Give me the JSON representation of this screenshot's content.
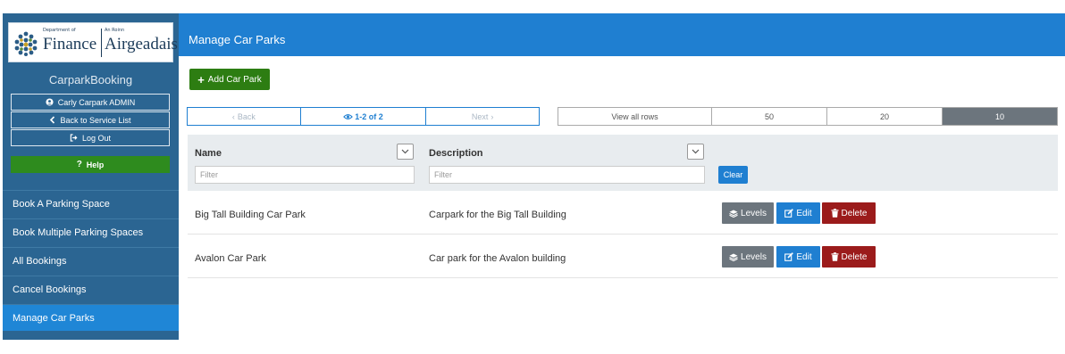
{
  "logo": {
    "dept_small": "Department of",
    "finance": "Finance",
    "an_roinn": "An Roinn",
    "airgeadais": "Airgeadais"
  },
  "sidebar": {
    "app_name": "CarparkBooking",
    "user_label": "Carly Carpark ADMIN",
    "back_label": "Back to Service List",
    "logout_label": "Log Out",
    "help_label": "Help",
    "nav": [
      {
        "label": "Book A Parking Space"
      },
      {
        "label": "Book Multiple Parking Spaces"
      },
      {
        "label": "All Bookings"
      },
      {
        "label": "Cancel Bookings"
      },
      {
        "label": "Manage Car Parks",
        "active": true
      }
    ]
  },
  "header": {
    "title": "Manage Car Parks"
  },
  "toolbar": {
    "add_label": "Add Car Park"
  },
  "pager": {
    "back": "Back",
    "info": "1-2 of 2",
    "next": "Next"
  },
  "rows_per_page": {
    "options": [
      "View all rows",
      "50",
      "20",
      "10"
    ],
    "selected": "10"
  },
  "table": {
    "columns": [
      "Name",
      "Description"
    ],
    "filter_placeholder": "Filter",
    "clear_label": "Clear",
    "actions": {
      "levels": "Levels",
      "edit": "Edit",
      "delete": "Delete"
    },
    "rows": [
      {
        "name": "Big Tall Building Car Park",
        "description": "Carpark for the Big Tall Building"
      },
      {
        "name": "Avalon Car Park",
        "description": "Car park for the Avalon building"
      }
    ]
  },
  "colors": {
    "sidebar": "#2b6592",
    "header": "#1f7fd1",
    "active_nav": "#1f86d6",
    "add_button": "#2d7d12",
    "help_button": "#2e8b1e",
    "delete_button": "#9b1b1b",
    "levels_button": "#6c757d"
  }
}
